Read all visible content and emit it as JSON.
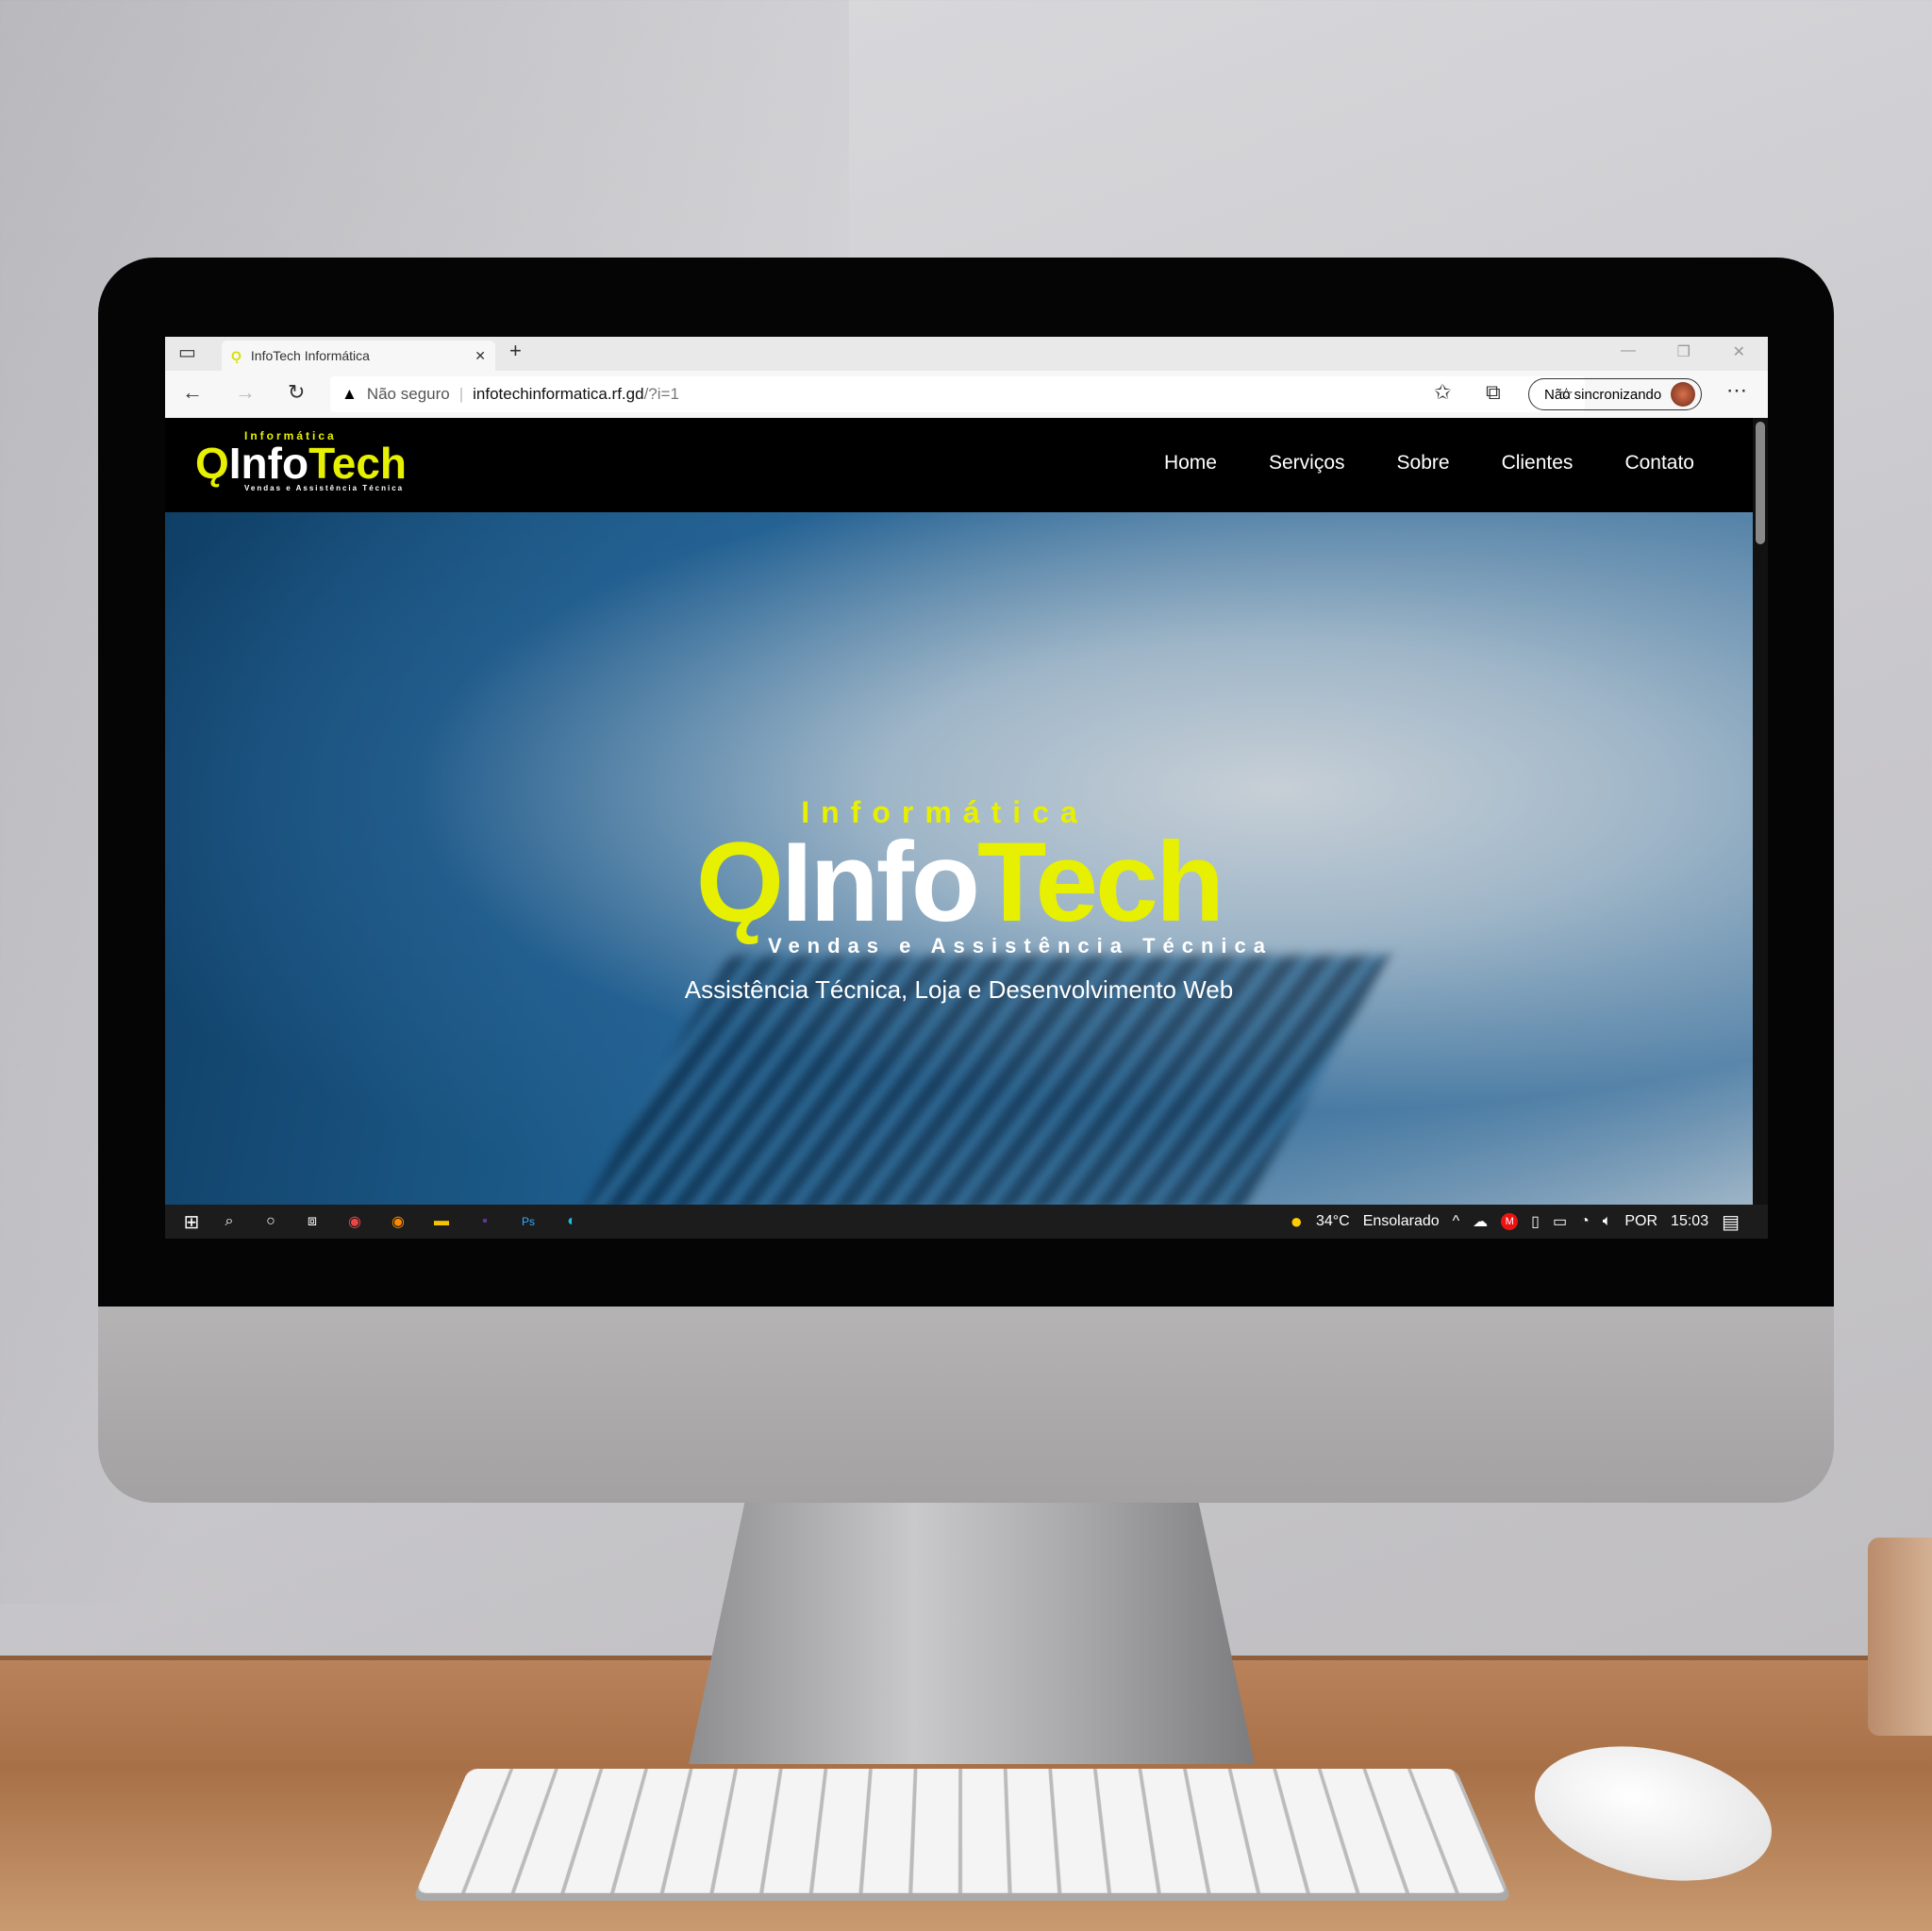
{
  "browser": {
    "tab_title": "InfoTech Informática",
    "security_label": "Não seguro",
    "url_domain": "infotechinformatica.rf.gd",
    "url_path": "/?i=1",
    "profile_label": "Não sincronizando"
  },
  "site": {
    "logo_top": "Informática",
    "logo_info": "Info",
    "logo_tech": "Tech",
    "logo_sub": "Vendas e Assistência Técnica",
    "nav": [
      "Home",
      "Serviços",
      "Sobre",
      "Clientes",
      "Contato"
    ],
    "hero_tagline": "Assistência Técnica, Loja e Desenvolvimento Web"
  },
  "taskbar": {
    "weather_temp": "34°C",
    "weather_text": "Ensolarado",
    "language": "POR",
    "time": "15:03"
  },
  "colors": {
    "accent": "#e6f000",
    "header_bg": "#000000"
  }
}
